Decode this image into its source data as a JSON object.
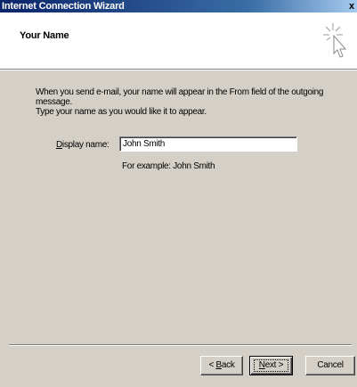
{
  "window": {
    "title": "Internet Connection Wizard",
    "close_label": "x"
  },
  "header": {
    "title": "Your Name",
    "icon": "wizard-cursor-sparkle-icon"
  },
  "body": {
    "intro_line1": "When you send e-mail, your name will appear in the From field of the outgoing message.",
    "intro_line2": "Type your name as you would like it to appear.",
    "display_label_first": "D",
    "display_label_rest": "isplay name:",
    "display_value": "John Smith",
    "example_text": "For example: John Smith"
  },
  "footer": {
    "back_prefix": "< ",
    "back_accel": "B",
    "back_rest": "ack",
    "next_accel": "N",
    "next_rest": "ext >",
    "cancel_label": "Cancel"
  }
}
